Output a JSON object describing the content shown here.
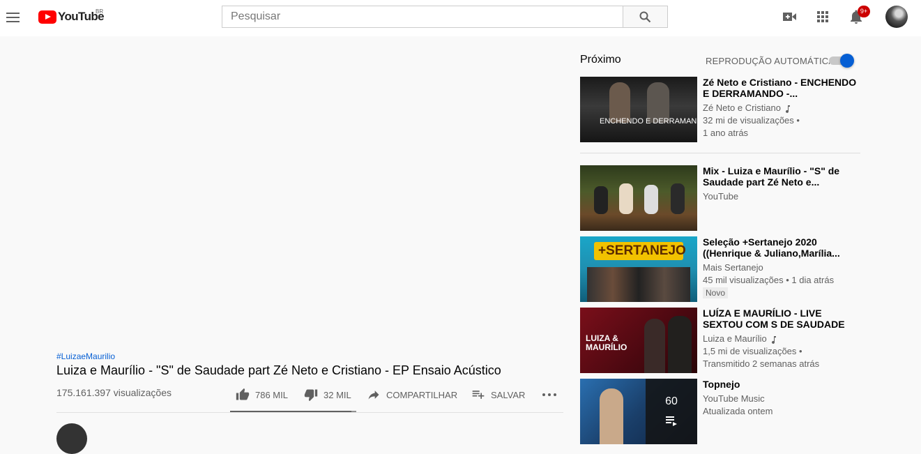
{
  "masthead": {
    "logo_text": "YouTube",
    "country": "BR",
    "search_placeholder": "Pesquisar",
    "notifications_badge": "9+"
  },
  "video": {
    "hashtag": "#LuizaeMaurilio",
    "title": "Luiza e Maurílio - \"S\" de Saudade part Zé Neto e Cristiano - EP Ensaio Acústico",
    "views": "175.161.397 visualizações",
    "likes": "786 MIL",
    "dislikes": "32 MIL",
    "share_label": "COMPARTILHAR",
    "save_label": "SALVAR",
    "like_ratio": 0.96
  },
  "sidebar": {
    "next_label": "Próximo",
    "autoplay_label": "REPRODUÇÃO AUTOMÁTICA",
    "autoplay_on": true,
    "items": [
      {
        "title": "Zé Neto e Cristiano - ENCHENDO E DERRAMANDO -...",
        "channel": "Zé Neto e Cristiano",
        "line2": "32 mi de visualizações •",
        "line3": "1 ano atrás",
        "thumb_text": "ENCHENDO E DERRAMANDO"
      },
      {
        "title": "Mix - Luiza e Maurílio - \"S\" de Saudade part Zé Neto e...",
        "channel": "YouTube"
      },
      {
        "title": "Seleção +Sertanejo 2020 ((Henrique & Juliano,Marília...",
        "channel": "Mais Sertanejo",
        "line2": "45 mil visualizações • 1 dia atrás",
        "badge": "Novo",
        "thumb_text": "+SERTANEJO"
      },
      {
        "title": "LUÍZA E MAURÍLIO - LIVE SEXTOU COM S DE SAUDADE",
        "channel": "Luiza e Maurílio",
        "line2": "1,5 mi de visualizações •",
        "line3": "Transmitido 2 semanas atrás",
        "thumb_text": "LUIZA & MAURÍLIO"
      },
      {
        "title": "Topnejo",
        "channel": "YouTube Music",
        "line2": "Atualizada ontem",
        "playlist_count": "60"
      }
    ]
  },
  "colors": {
    "brand_red": "#ff0000",
    "accent_blue": "#065fd4",
    "badge_red": "#cc0000"
  }
}
